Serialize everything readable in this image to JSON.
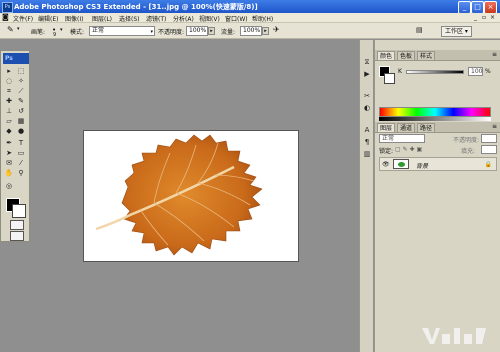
{
  "app": {
    "ps_short": "Ps",
    "title": "Adobe Photoshop CS3 Extended - [31..jpg @ 100%(快速蒙版/8)]",
    "window_buttons": [
      "_",
      "□",
      "×"
    ]
  },
  "menu": [
    "文件(F)",
    "编辑(E)",
    "图像(I)",
    "图层(L)",
    "选择(S)",
    "滤镜(T)",
    "分析(A)",
    "视图(V)",
    "窗口(W)",
    "帮助(H)"
  ],
  "options": {
    "brush_label": "画笔:",
    "brush_size": "9",
    "mode_label": "模式:",
    "mode_value": "正常",
    "opacity_label": "不透明度:",
    "opacity_value": "100%",
    "flow_label": "流量:",
    "flow_value": "100%",
    "workspace": "工作区 ▾"
  },
  "color_panel": {
    "tabs": [
      "颜色",
      "色板",
      "样式"
    ],
    "channel_label": "K",
    "value": "100",
    "unit": "%"
  },
  "layers_panel": {
    "tabs": [
      "图层",
      "通道",
      "路径"
    ],
    "blend_mode": "正常",
    "opacity_label": "不透明度:",
    "lock_label": "锁定:",
    "fill_label": "填充:",
    "layer_name": "背景"
  },
  "colors": {
    "titlebar": "#2a63d6",
    "leaf": "#c96a1a",
    "foreground": "#000000",
    "background": "#ffffff"
  }
}
